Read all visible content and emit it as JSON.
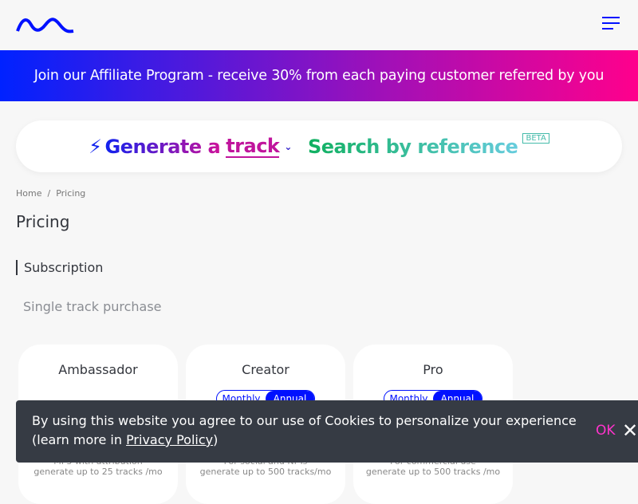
{
  "header": {
    "logo_icon": "wave-logo-icon",
    "menu_icon": "hamburger-menu-icon"
  },
  "banner": {
    "text": "Join our Affiliate Program - receive 30% from each paying customer referred by you"
  },
  "generator": {
    "prefix": "Generate a",
    "type": "track",
    "search": "Search by reference",
    "beta": "BETA"
  },
  "breadcrumb": {
    "home": "Home",
    "sep": "/",
    "current": "Pricing"
  },
  "page_title": "Pricing",
  "tabs": {
    "subscription": "Subscription",
    "single": "Single track purchase"
  },
  "plans": [
    {
      "name": "Ambassador",
      "desc1": "MP3 with attribution",
      "desc2": "generate up to 25 tracks /mo"
    },
    {
      "name": "Creator",
      "toggle": [
        "Monthly",
        "Annual"
      ],
      "desc1": "For social and NFTs",
      "desc2": "generate up to 500 tracks/mo"
    },
    {
      "name": "Pro",
      "toggle": [
        "Monthly",
        "Annual"
      ],
      "desc1": "For commercial use",
      "desc2": "generate up to 500 tracks /mo"
    }
  ],
  "cookie": {
    "text": "By using this website you agree to our use of Cookies to personalize your experience (learn more in ",
    "link": "Privacy Policy",
    "end": ")",
    "ok": "OK",
    "close": "✕"
  },
  "colors": {
    "brand": "#0011ff",
    "pink": "#ff008c"
  }
}
